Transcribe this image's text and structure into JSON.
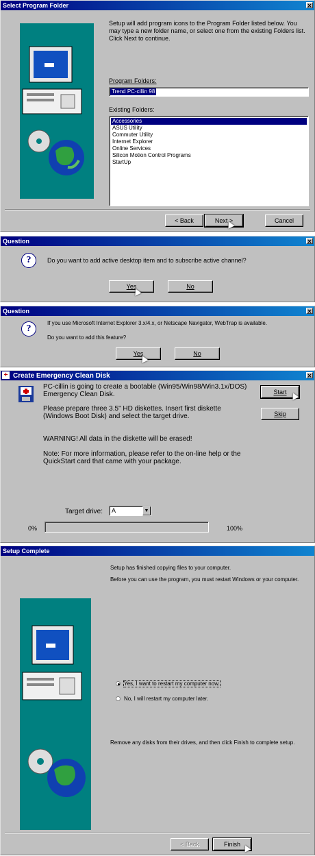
{
  "dialog1": {
    "title": "Select Program Folder",
    "intro": "Setup will add program icons to the Program Folder listed below. You may type a new folder name, or select one from the existing Folders list.  Click Next to continue.",
    "program_folder_label": "Program Folders:",
    "program_folder_value": "Trend PC-cillin 98",
    "existing_label": "Existing Folders:",
    "folders": [
      "Accessories",
      "ASUS Utility",
      "Commuter Utility",
      "Internet Explorer",
      "Online Services",
      "Silicon Motion Control Programs",
      "StartUp"
    ],
    "back": "< Back",
    "next": "Next >",
    "cancel": "Cancel"
  },
  "dialog2": {
    "title": "Question",
    "message": "Do you want to add active desktop item and to subscribe active channel?",
    "yes": "Yes",
    "no": "No"
  },
  "dialog3": {
    "title": "Question",
    "message_line1": "If you use Microsoft Internet Explorer 3.x/4.x, or Netscape Navigator, WebTrap is available.",
    "message_line2": "Do you want to add this feature?",
    "yes": "Yes",
    "no": "No"
  },
  "dialog4": {
    "title": "Create Emergency Clean Disk",
    "p1": "PC-cillin is going to create a bootable (Win95/Win98/Win3.1x/DOS) Emergency Clean Disk.",
    "p2": "Please prepare three 3.5\" HD diskettes.  Insert first diskette (Windows Boot Disk) and select the target drive.",
    "p3": "WARNING! All data in the diskette will be erased!",
    "p4": "Note: For more information, please refer to the on-line help or the QuickStart card that came with your package.",
    "start": "Start",
    "skip": "Skip",
    "target_label": "Target drive:",
    "target_value": "A",
    "progress_min": "0%",
    "progress_max": "100%",
    "progress_value": 0
  },
  "dialog5": {
    "title": "Setup Complete",
    "p1": "Setup has finished copying files to your computer.",
    "p2": "Before you can use the program, you must restart Windows or your computer.",
    "opt1": "Yes, I want to restart my computer now.",
    "opt2": "No, I will restart my computer later.",
    "p3": "Remove any disks from their drives, and then click Finish to complete setup.",
    "back": "< Back",
    "finish": "Finish"
  }
}
